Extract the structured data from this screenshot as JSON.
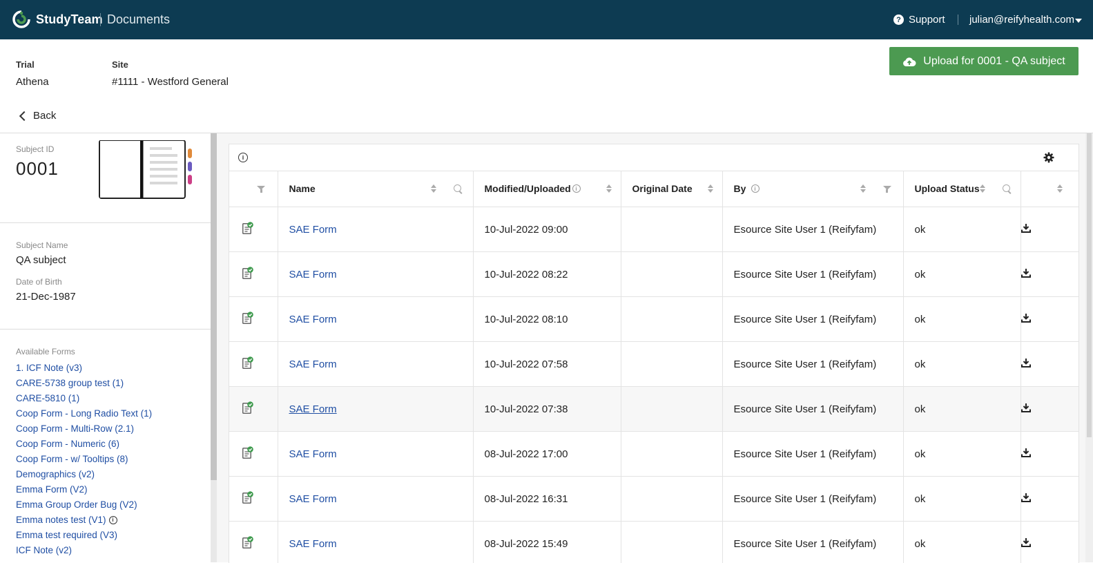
{
  "topbar": {
    "brand": "StudyTeam",
    "section": "Documents",
    "support_label": "Support",
    "user_email": "julian@reifyhealth.com"
  },
  "header": {
    "trial_label": "Trial",
    "trial_value": "Athena",
    "site_label": "Site",
    "site_value": "#1111 - Westford General",
    "upload_button": "Upload for 0001 - QA subject",
    "back_label": "Back"
  },
  "subject": {
    "id_label": "Subject ID",
    "id_value": "0001",
    "name_label": "Subject Name",
    "name_value": "QA subject",
    "dob_label": "Date of Birth",
    "dob_value": "21-Dec-1987"
  },
  "forms": {
    "label": "Available Forms",
    "items": [
      "1. ICF Note (v3)",
      "CARE-5738 group test (1)",
      "CARE-5810 (1)",
      "Coop Form - Long Radio Text (1)",
      "Coop Form - Multi-Row (2.1)",
      "Coop Form - Numeric (6)",
      "Coop Form - w/ Tooltips (8)",
      "Demographics (v2)",
      "Emma Form (V2)",
      "Emma Group Order Bug (V2)",
      "Emma notes test (V1)",
      "Emma test required (V3)",
      "ICF Note (v2)"
    ]
  },
  "table": {
    "columns": [
      "Name",
      "Modified/Uploaded",
      "Original Date",
      "By",
      "Upload Status"
    ],
    "rows": [
      {
        "name": "SAE Form",
        "modified": "10-Jul-2022 09:00",
        "original": "",
        "by": "Esource Site User 1 (Reifyfam)",
        "status": "ok"
      },
      {
        "name": "SAE Form",
        "modified": "10-Jul-2022 08:22",
        "original": "",
        "by": "Esource Site User 1 (Reifyfam)",
        "status": "ok"
      },
      {
        "name": "SAE Form",
        "modified": "10-Jul-2022 08:10",
        "original": "",
        "by": "Esource Site User 1 (Reifyfam)",
        "status": "ok"
      },
      {
        "name": "SAE Form",
        "modified": "10-Jul-2022 07:58",
        "original": "",
        "by": "Esource Site User 1 (Reifyfam)",
        "status": "ok"
      },
      {
        "name": "SAE Form",
        "modified": "10-Jul-2022 07:38",
        "original": "",
        "by": "Esource Site User 1 (Reifyfam)",
        "status": "ok"
      },
      {
        "name": "SAE Form",
        "modified": "08-Jul-2022 17:00",
        "original": "",
        "by": "Esource Site User 1 (Reifyfam)",
        "status": "ok"
      },
      {
        "name": "SAE Form",
        "modified": "08-Jul-2022 16:31",
        "original": "",
        "by": "Esource Site User 1 (Reifyfam)",
        "status": "ok"
      },
      {
        "name": "SAE Form",
        "modified": "08-Jul-2022 15:49",
        "original": "",
        "by": "Esource Site User 1 (Reifyfam)",
        "status": "ok"
      }
    ]
  },
  "colors": {
    "topbar": "#0d3b52",
    "accent_green": "#4c9a51",
    "link_blue": "#1f4ea3"
  }
}
